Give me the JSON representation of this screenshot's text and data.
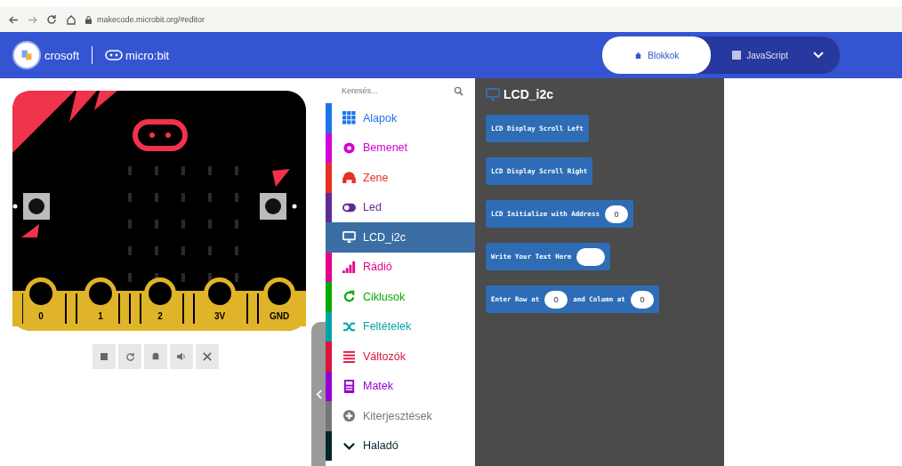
{
  "browser": {
    "address": "makecode.microbit.org/#editor"
  },
  "header": {
    "brand": "crosoft",
    "product": "micro:bit",
    "modes": [
      {
        "label": "Blokkok",
        "selected": true
      },
      {
        "label": "JavaScript",
        "selected": false
      }
    ]
  },
  "simulator": {
    "pins": [
      "0",
      "1",
      "2",
      "3V",
      "GND"
    ]
  },
  "toolbox": {
    "search": {
      "placeholder": "Keresés..."
    },
    "categories": [
      {
        "label": "Alapok",
        "color": "#1e73e8",
        "selected": false
      },
      {
        "label": "Bemenet",
        "color": "#d400d4",
        "selected": false
      },
      {
        "label": "Zene",
        "color": "#e63022",
        "selected": false
      },
      {
        "label": "Led",
        "color": "#5c2d91",
        "selected": false
      },
      {
        "label": "LCD_i2c",
        "color": "#3a6ea5",
        "selected": true
      },
      {
        "label": "Rádió",
        "color": "#e3008c",
        "selected": false
      },
      {
        "label": "Ciklusok",
        "color": "#00aa00",
        "selected": false
      },
      {
        "label": "Feltételek",
        "color": "#00a4a6",
        "selected": false
      },
      {
        "label": "Változók",
        "color": "#dc143c",
        "selected": false
      },
      {
        "label": "Matek",
        "color": "#9400d3",
        "selected": false
      },
      {
        "label": "Kiterjesztések",
        "color": "#777777",
        "selected": false
      },
      {
        "label": "Haladó",
        "color": "#00272b",
        "selected": false
      }
    ]
  },
  "flyout": {
    "title": "LCD_i2c",
    "blocks": [
      {
        "parts": [
          {
            "kind": "text",
            "value": "LCD Display Scroll Left"
          }
        ]
      },
      {
        "parts": [
          {
            "kind": "text",
            "value": "LCD Display Scroll Right"
          }
        ]
      },
      {
        "parts": [
          {
            "kind": "text",
            "value": "LCD Initialize with Address"
          },
          {
            "kind": "number",
            "value": "0"
          }
        ]
      },
      {
        "parts": [
          {
            "kind": "text",
            "value": "Write Your Text Here"
          },
          {
            "kind": "string"
          }
        ]
      },
      {
        "parts": [
          {
            "kind": "text",
            "value": "Enter Row at"
          },
          {
            "kind": "number",
            "value": "0"
          },
          {
            "kind": "text",
            "value": "and Column at"
          },
          {
            "kind": "number",
            "value": "0"
          }
        ]
      }
    ]
  }
}
